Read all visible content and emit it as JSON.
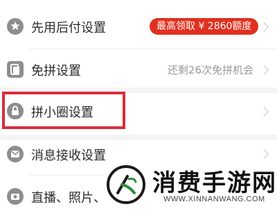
{
  "menu": {
    "items": [
      {
        "label": "先用后付设置",
        "badge": "最高领取 ¥ 2860额度",
        "hint": ""
      },
      {
        "label": "免拼设置",
        "badge": "",
        "hint": "还剩26次免拼机会"
      },
      {
        "label": "拼小圈设置",
        "badge": "",
        "hint": ""
      },
      {
        "label": "消息接收设置",
        "badge": "",
        "hint": ""
      },
      {
        "label": "直播、照片、",
        "badge": "",
        "hint": ""
      }
    ]
  },
  "watermark": {
    "brand": "消费手游网",
    "url": "WWW.XINNANWANG.COM"
  },
  "colors": {
    "badge_bg": "#e1301f",
    "highlight_border": "#d82d3a",
    "icon_gray": "#8d8d8d"
  }
}
